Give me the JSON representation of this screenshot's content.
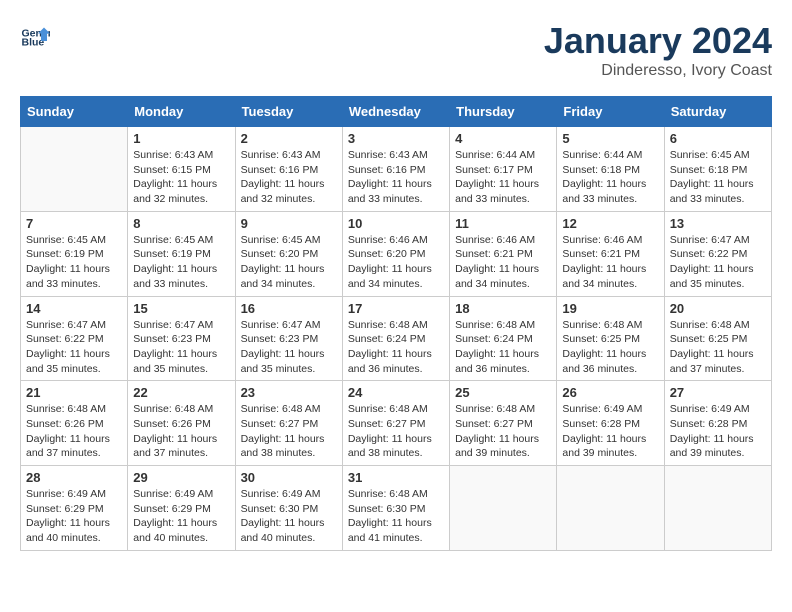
{
  "logo": {
    "line1": "General",
    "line2": "Blue"
  },
  "title": "January 2024",
  "subtitle": "Dinderesso, Ivory Coast",
  "weekdays": [
    "Sunday",
    "Monday",
    "Tuesday",
    "Wednesday",
    "Thursday",
    "Friday",
    "Saturday"
  ],
  "weeks": [
    [
      {
        "day": null,
        "info": ""
      },
      {
        "day": "1",
        "info": "Sunrise: 6:43 AM\nSunset: 6:15 PM\nDaylight: 11 hours\nand 32 minutes."
      },
      {
        "day": "2",
        "info": "Sunrise: 6:43 AM\nSunset: 6:16 PM\nDaylight: 11 hours\nand 32 minutes."
      },
      {
        "day": "3",
        "info": "Sunrise: 6:43 AM\nSunset: 6:16 PM\nDaylight: 11 hours\nand 33 minutes."
      },
      {
        "day": "4",
        "info": "Sunrise: 6:44 AM\nSunset: 6:17 PM\nDaylight: 11 hours\nand 33 minutes."
      },
      {
        "day": "5",
        "info": "Sunrise: 6:44 AM\nSunset: 6:18 PM\nDaylight: 11 hours\nand 33 minutes."
      },
      {
        "day": "6",
        "info": "Sunrise: 6:45 AM\nSunset: 6:18 PM\nDaylight: 11 hours\nand 33 minutes."
      }
    ],
    [
      {
        "day": "7",
        "info": "Sunrise: 6:45 AM\nSunset: 6:19 PM\nDaylight: 11 hours\nand 33 minutes."
      },
      {
        "day": "8",
        "info": "Sunrise: 6:45 AM\nSunset: 6:19 PM\nDaylight: 11 hours\nand 33 minutes."
      },
      {
        "day": "9",
        "info": "Sunrise: 6:45 AM\nSunset: 6:20 PM\nDaylight: 11 hours\nand 34 minutes."
      },
      {
        "day": "10",
        "info": "Sunrise: 6:46 AM\nSunset: 6:20 PM\nDaylight: 11 hours\nand 34 minutes."
      },
      {
        "day": "11",
        "info": "Sunrise: 6:46 AM\nSunset: 6:21 PM\nDaylight: 11 hours\nand 34 minutes."
      },
      {
        "day": "12",
        "info": "Sunrise: 6:46 AM\nSunset: 6:21 PM\nDaylight: 11 hours\nand 34 minutes."
      },
      {
        "day": "13",
        "info": "Sunrise: 6:47 AM\nSunset: 6:22 PM\nDaylight: 11 hours\nand 35 minutes."
      }
    ],
    [
      {
        "day": "14",
        "info": "Sunrise: 6:47 AM\nSunset: 6:22 PM\nDaylight: 11 hours\nand 35 minutes."
      },
      {
        "day": "15",
        "info": "Sunrise: 6:47 AM\nSunset: 6:23 PM\nDaylight: 11 hours\nand 35 minutes."
      },
      {
        "day": "16",
        "info": "Sunrise: 6:47 AM\nSunset: 6:23 PM\nDaylight: 11 hours\nand 35 minutes."
      },
      {
        "day": "17",
        "info": "Sunrise: 6:48 AM\nSunset: 6:24 PM\nDaylight: 11 hours\nand 36 minutes."
      },
      {
        "day": "18",
        "info": "Sunrise: 6:48 AM\nSunset: 6:24 PM\nDaylight: 11 hours\nand 36 minutes."
      },
      {
        "day": "19",
        "info": "Sunrise: 6:48 AM\nSunset: 6:25 PM\nDaylight: 11 hours\nand 36 minutes."
      },
      {
        "day": "20",
        "info": "Sunrise: 6:48 AM\nSunset: 6:25 PM\nDaylight: 11 hours\nand 37 minutes."
      }
    ],
    [
      {
        "day": "21",
        "info": "Sunrise: 6:48 AM\nSunset: 6:26 PM\nDaylight: 11 hours\nand 37 minutes."
      },
      {
        "day": "22",
        "info": "Sunrise: 6:48 AM\nSunset: 6:26 PM\nDaylight: 11 hours\nand 37 minutes."
      },
      {
        "day": "23",
        "info": "Sunrise: 6:48 AM\nSunset: 6:27 PM\nDaylight: 11 hours\nand 38 minutes."
      },
      {
        "day": "24",
        "info": "Sunrise: 6:48 AM\nSunset: 6:27 PM\nDaylight: 11 hours\nand 38 minutes."
      },
      {
        "day": "25",
        "info": "Sunrise: 6:48 AM\nSunset: 6:27 PM\nDaylight: 11 hours\nand 39 minutes."
      },
      {
        "day": "26",
        "info": "Sunrise: 6:49 AM\nSunset: 6:28 PM\nDaylight: 11 hours\nand 39 minutes."
      },
      {
        "day": "27",
        "info": "Sunrise: 6:49 AM\nSunset: 6:28 PM\nDaylight: 11 hours\nand 39 minutes."
      }
    ],
    [
      {
        "day": "28",
        "info": "Sunrise: 6:49 AM\nSunset: 6:29 PM\nDaylight: 11 hours\nand 40 minutes."
      },
      {
        "day": "29",
        "info": "Sunrise: 6:49 AM\nSunset: 6:29 PM\nDaylight: 11 hours\nand 40 minutes."
      },
      {
        "day": "30",
        "info": "Sunrise: 6:49 AM\nSunset: 6:30 PM\nDaylight: 11 hours\nand 40 minutes."
      },
      {
        "day": "31",
        "info": "Sunrise: 6:48 AM\nSunset: 6:30 PM\nDaylight: 11 hours\nand 41 minutes."
      },
      {
        "day": null,
        "info": ""
      },
      {
        "day": null,
        "info": ""
      },
      {
        "day": null,
        "info": ""
      }
    ]
  ]
}
